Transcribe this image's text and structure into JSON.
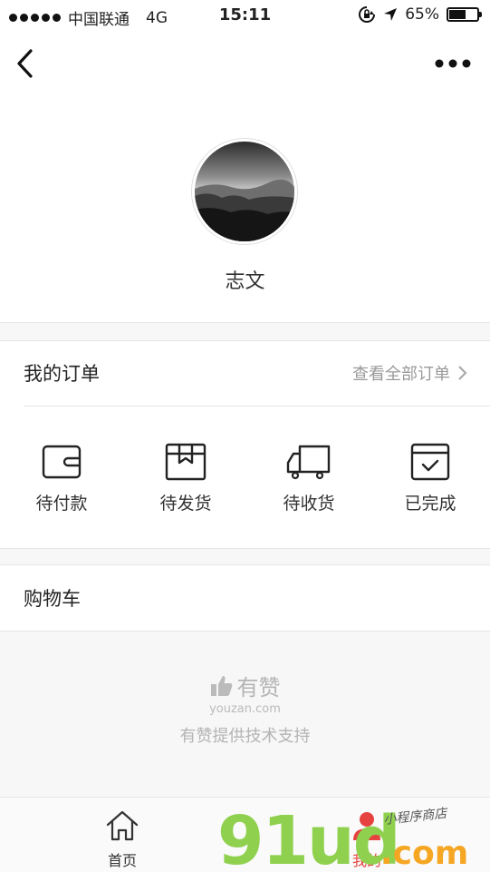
{
  "status_bar": {
    "carrier": "中国联通",
    "network": "4G",
    "time": "15:11",
    "battery": "65%",
    "battery_level": 0.65
  },
  "nav": {
    "back_icon": "chevron-left-icon",
    "more_icon": "more-dots-icon"
  },
  "profile": {
    "name": "志文"
  },
  "orders": {
    "title": "我的订单",
    "view_all": "查看全部订单",
    "items": [
      {
        "label": "待付款",
        "icon": "wallet-icon"
      },
      {
        "label": "待发货",
        "icon": "package-icon"
      },
      {
        "label": "待收货",
        "icon": "truck-icon"
      },
      {
        "label": "已完成",
        "icon": "checked-box-icon"
      }
    ]
  },
  "cart": {
    "title": "购物车"
  },
  "brand": {
    "name": "有赞",
    "domain": "youzan.com",
    "support": "有赞提供技术支持"
  },
  "tabbar": {
    "items": [
      {
        "label": "首页",
        "icon": "home-icon"
      },
      {
        "label": "我的",
        "icon": "user-icon"
      }
    ]
  },
  "watermark": {
    "text": "91ud",
    "suffix": ".com",
    "tagline": "小程序商店"
  },
  "colors": {
    "accent": "#e64340",
    "watermark_green": "#8fd14f",
    "watermark_orange": "#f5a623"
  }
}
